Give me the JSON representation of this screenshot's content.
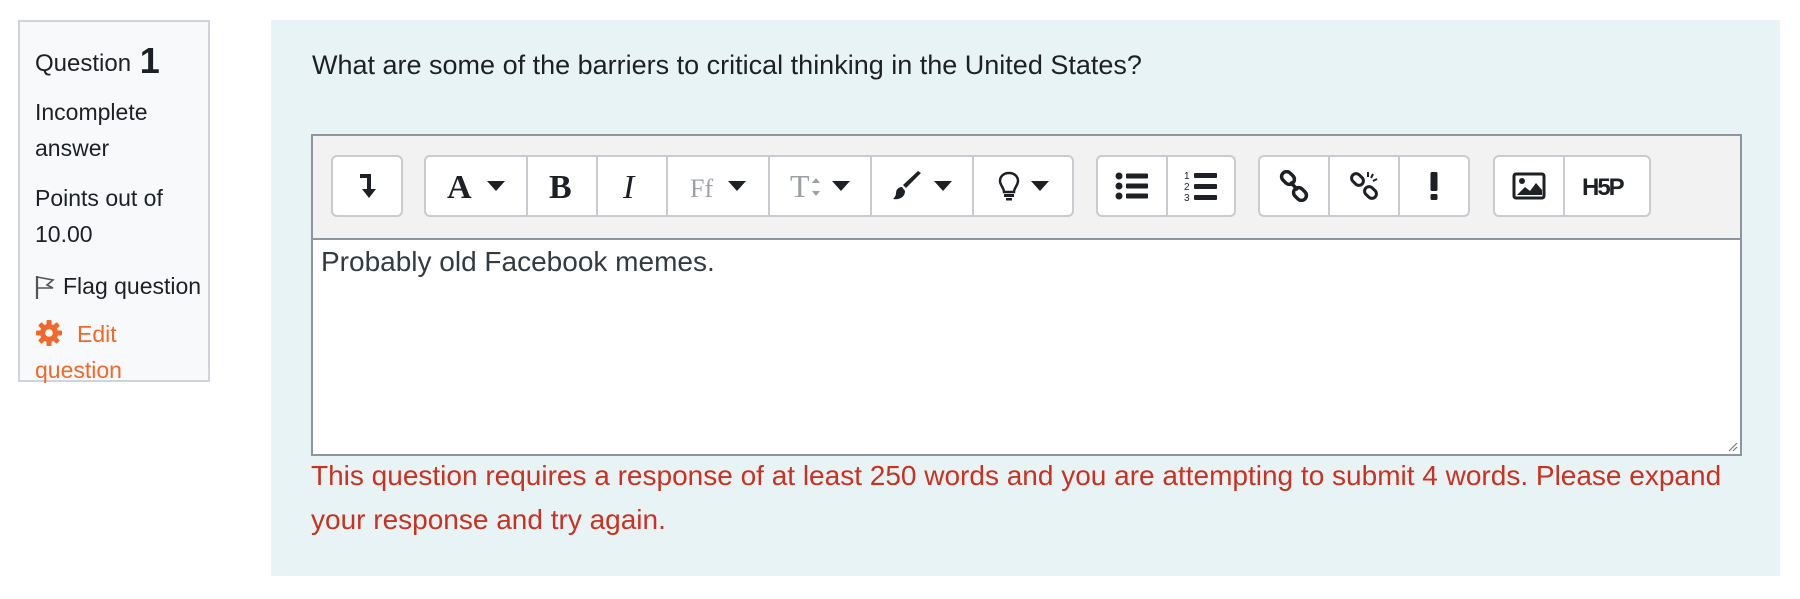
{
  "info": {
    "question_label": "Question",
    "question_number": "1",
    "state": "Incomplete answer",
    "grade": "Points out of 10.00",
    "flag_label": "Flag question",
    "edit_label": "Edit question"
  },
  "question": {
    "text": "What are some of the barriers to critical thinking in the United States?"
  },
  "editor": {
    "toolbar": [
      {
        "name": "toggle-toolbar",
        "icon": "arrow-down-icon"
      },
      {
        "name": "font-color",
        "icon": "font-color-icon"
      },
      {
        "name": "bold",
        "icon": "bold-icon"
      },
      {
        "name": "italic",
        "icon": "italic-icon"
      },
      {
        "name": "font-family",
        "icon": "font-family-icon"
      },
      {
        "name": "font-size",
        "icon": "font-size-icon"
      },
      {
        "name": "highlight",
        "icon": "paintbrush-icon"
      },
      {
        "name": "styles",
        "icon": "lightbulb-icon"
      },
      {
        "name": "unordered-list",
        "icon": "bullet-list-icon"
      },
      {
        "name": "ordered-list",
        "icon": "numbered-list-icon"
      },
      {
        "name": "link",
        "icon": "link-icon"
      },
      {
        "name": "unlink",
        "icon": "unlink-icon"
      },
      {
        "name": "accessibility-checker",
        "icon": "exclamation-icon"
      },
      {
        "name": "image",
        "icon": "image-icon"
      },
      {
        "name": "h5p",
        "icon": "h5p-icon"
      }
    ],
    "value": "Probably old Facebook memes."
  },
  "error": {
    "message": "This question requires a response of at least 250 words and you are attempting to submit 4 words. Please expand your response and try again."
  },
  "colors": {
    "edit_link": "#f0682c",
    "error": "#ca3120",
    "content_bg": "#e7f3f5",
    "info_bg": "#f8f9fa"
  }
}
